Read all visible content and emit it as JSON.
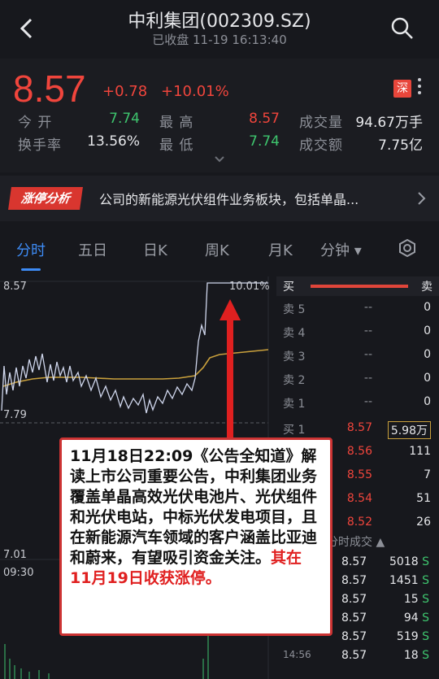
{
  "header": {
    "title": "中利集团(002309.SZ)",
    "subtitle": "已收盘 11-19 16:13:40"
  },
  "quote": {
    "price": "8.57",
    "change": "+0.78",
    "change_pct": "+10.01%",
    "exchange_badge": "深",
    "stats": [
      {
        "label": "今 开",
        "value": "7.74",
        "color": "green"
      },
      {
        "label": "最 高",
        "value": "8.57",
        "color": "red"
      },
      {
        "label": "成交量",
        "value": "94.67万手",
        "color": "white"
      },
      {
        "label": "换手率",
        "value": "13.56%",
        "color": "white"
      },
      {
        "label": "最 低",
        "value": "7.74",
        "color": "green"
      },
      {
        "label": "成交额",
        "value": "7.75亿",
        "color": "white"
      }
    ]
  },
  "banner": {
    "tag": "涨停分析",
    "text": "公司的新能源光伏组件业务板块，包括单晶..."
  },
  "tabs": [
    "分时",
    "五日",
    "日K",
    "周K",
    "月K",
    "分钟 ▾"
  ],
  "chart": {
    "high_label": "8.57",
    "high_pct": "10.01%",
    "prev_label": "7.79",
    "low_label": "7.01",
    "start_time": "09:30"
  },
  "orderbook": {
    "buy_label": "买",
    "sell_label": "卖",
    "asks": [
      {
        "label": "卖 5",
        "price": "--",
        "qty": "0"
      },
      {
        "label": "卖 4",
        "price": "--",
        "qty": "0"
      },
      {
        "label": "卖 3",
        "price": "--",
        "qty": "0"
      },
      {
        "label": "卖 2",
        "price": "--",
        "qty": "0"
      },
      {
        "label": "卖 1",
        "price": "--",
        "qty": "0"
      }
    ],
    "bids": [
      {
        "label": "买 1",
        "price": "8.57",
        "qty": "5.98万"
      },
      {
        "label": "买 2",
        "price": "8.56",
        "qty": "111"
      },
      {
        "label": "买 3",
        "price": "8.55",
        "qty": "7"
      },
      {
        "label": "买 4",
        "price": "8.54",
        "qty": "51"
      },
      {
        "label": "买 5",
        "price": "8.52",
        "qty": "26"
      }
    ],
    "trades_header": "分时成交 ▲",
    "trades": [
      {
        "time": "",
        "price": "8.57",
        "vol": "5018",
        "side": "S"
      },
      {
        "time": "",
        "price": "8.57",
        "vol": "1451",
        "side": "S"
      },
      {
        "time": "",
        "price": "8.57",
        "vol": "15",
        "side": "S"
      },
      {
        "time": "",
        "price": "8.57",
        "vol": "94",
        "side": "S"
      },
      {
        "time": "",
        "price": "8.57",
        "vol": "519",
        "side": "S"
      },
      {
        "time": "14:56",
        "price": "8.57",
        "vol": "18",
        "side": "S"
      }
    ]
  },
  "note": {
    "text": "11月18日22:09《公告全知道》解读上市公司重要公告，中利集团业务覆盖单晶高效光伏电池片、光伏组件和光伏电站，中标光伏发电项目，且在新能源汽车领域的客户涵盖比亚迪和蔚来，有望吸引资金关注。",
    "highlight": "其在11月19日收获涨停。"
  }
}
